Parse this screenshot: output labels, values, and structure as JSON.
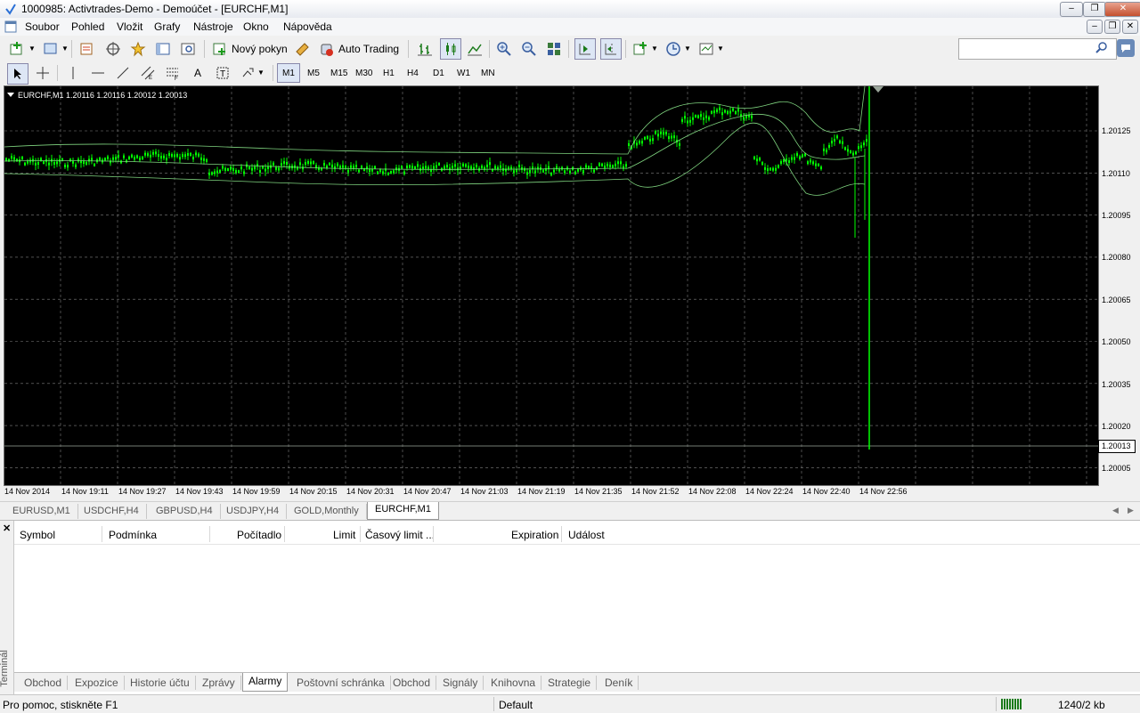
{
  "window": {
    "title": "1000985: Activtrades-Demo - Demoúčet - [EURCHF,M1]"
  },
  "menu": [
    "Soubor",
    "Pohled",
    "Vložit",
    "Grafy",
    "Nástroje",
    "Okno",
    "Nápověda"
  ],
  "toolbar": {
    "new_order_label": "Nový pokyn",
    "auto_trading_label": "Auto Trading",
    "search_placeholder": ""
  },
  "timeframes": [
    "M1",
    "M5",
    "M15",
    "M30",
    "H1",
    "H4",
    "D1",
    "W1",
    "MN"
  ],
  "chart": {
    "header": "EURCHF,M1  1.20116 1.20116 1.20012 1.20013",
    "y_labels": [
      "1.20125",
      "1.20110",
      "1.20095",
      "1.20080",
      "1.20065",
      "1.20050",
      "1.20035",
      "1.20020",
      "1.20005"
    ],
    "current_price": "1.20013",
    "x_labels": [
      "14 Nov 2014",
      "14 Nov 19:11",
      "14 Nov 19:27",
      "14 Nov 19:43",
      "14 Nov 19:59",
      "14 Nov 20:15",
      "14 Nov 20:31",
      "14 Nov 20:47",
      "14 Nov 21:03",
      "14 Nov 21:19",
      "14 Nov 21:35",
      "14 Nov 21:52",
      "14 Nov 22:08",
      "14 Nov 22:24",
      "14 Nov 22:40",
      "14 Nov 22:56"
    ],
    "colors": {
      "background": "#000000",
      "candle": "#00ff00",
      "bands": "#7fd47f",
      "grid": "#808080"
    }
  },
  "chart_tabs": [
    "EURUSD,M1",
    "USDCHF,H4",
    "GBPUSD,H4",
    "USDJPY,H4",
    "GOLD,Monthly",
    "EURCHF,M1"
  ],
  "chart_tabs_active": "EURCHF,M1",
  "terminal": {
    "side_label": "Terminál",
    "columns": [
      "Symbol",
      "Podmínka",
      "Počítadlo",
      "Limit",
      "Časový limit ...",
      "Expiration",
      "Událost"
    ],
    "tabs": [
      "Obchod",
      "Expozice",
      "Historie účtu",
      "Zprávy",
      "Alarmy",
      "Poštovní schránka",
      "Obchod",
      "Signály",
      "Knihovna",
      "Strategie",
      "Deník"
    ],
    "active_tab": "Alarmy"
  },
  "status": {
    "help": "Pro pomoc, stiskněte F1",
    "profile": "Default",
    "traffic": "1240/2 kb"
  }
}
